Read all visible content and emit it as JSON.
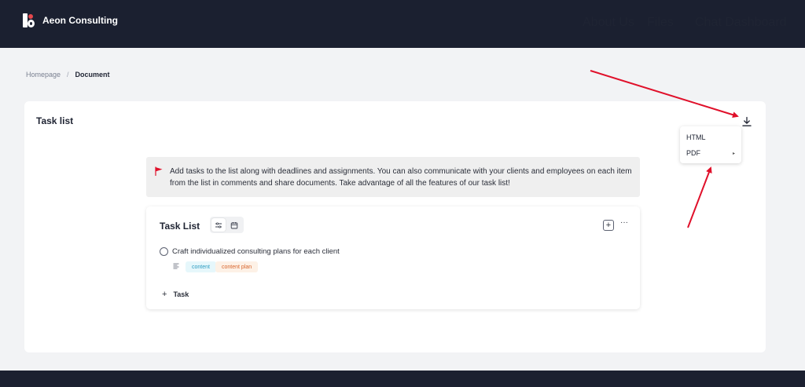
{
  "header": {
    "brand_name": "Aeon Consulting",
    "nav": [
      {
        "label": "About Us"
      },
      {
        "label": "Files"
      },
      {
        "label": "Chat Dashboard"
      }
    ]
  },
  "breadcrumb": {
    "home": "Homepage",
    "separator": "/",
    "current": "Document"
  },
  "panel": {
    "title": "Task list",
    "download_menu": {
      "items": [
        {
          "label": "HTML"
        },
        {
          "label": "PDF",
          "has_submenu": true
        }
      ]
    }
  },
  "notice": {
    "icon": "flag-icon",
    "text": "Add tasks to the list along with deadlines and assignments. You can also communicate with your clients and employees on each item from the list in comments and share documents. Take advantage of all the features of our task list!"
  },
  "task_list": {
    "title": "Task List",
    "tasks": [
      {
        "name": "Craft individualized consulting plans for each client",
        "tags": [
          {
            "label": "content"
          },
          {
            "label": "content plan"
          }
        ]
      }
    ],
    "add_task_label": "Task"
  },
  "colors": {
    "header_bg": "#1b2030",
    "page_bg": "#f2f3f5",
    "accent_red": "#e0102a",
    "tag_content": "#2b9bc1",
    "tag_plan": "#d8642c"
  }
}
